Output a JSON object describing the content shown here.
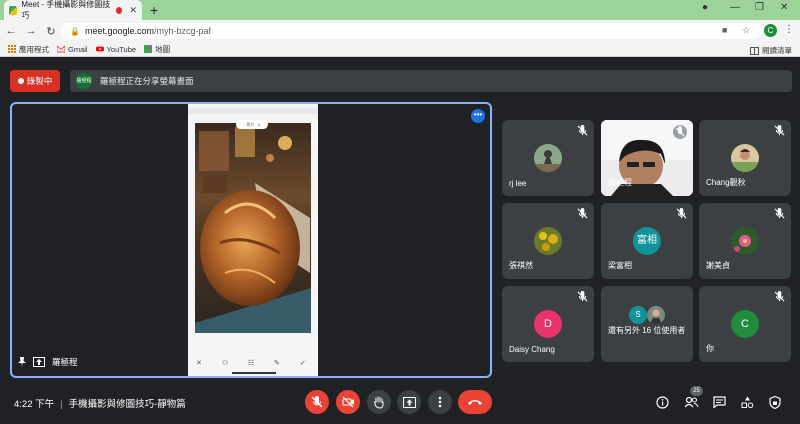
{
  "browser": {
    "tab_title": "Meet - 手機攝影與修圖技巧",
    "url_host": "meet.google.com",
    "url_path": "/myh-bzcg-paf",
    "profile_initial": "C",
    "bookmarks": [
      {
        "label": "應用程式",
        "icon": "apps-grid-icon"
      },
      {
        "label": "Gmail",
        "icon": "gmail-icon"
      },
      {
        "label": "YouTube",
        "icon": "youtube-icon"
      },
      {
        "label": "地圖",
        "icon": "maps-icon"
      }
    ],
    "reading_list": "閱讀清單"
  },
  "meet": {
    "recording_label": "錄製中",
    "presenter_avatar_text": "羅極程",
    "share_banner_text": "羅極程正在分享螢幕畫面",
    "presenter_name": "羅極程",
    "phone_pill_text": "· 原片 · 0",
    "participants": [
      {
        "name": "rj lee",
        "type": "photo"
      },
      {
        "name": "羅極程",
        "type": "video"
      },
      {
        "name": "Chang觀秋",
        "type": "photo"
      },
      {
        "name": "張祺然",
        "type": "photo"
      },
      {
        "name": "梁富相",
        "type": "initials",
        "initials": "富相",
        "color": "#12939a"
      },
      {
        "name": "謝美貞",
        "type": "photo"
      },
      {
        "name": "Daisy Chang",
        "type": "initials",
        "initials": "D",
        "color": "#e8336d"
      },
      {
        "name": "還有另外 16 位使用者",
        "type": "group",
        "initials": "S",
        "color": "#12939a"
      },
      {
        "name": "你",
        "type": "initials",
        "initials": "C",
        "color": "#1e8e3e"
      }
    ],
    "time": "4:22 下午",
    "meeting_title": "手機攝影與修圖技巧-靜物篇",
    "participant_count": "25",
    "colors": {
      "accent": "#8ab4f8",
      "danger": "#ea4335",
      "tile_bg": "#3c4043",
      "page_bg": "#202124"
    }
  }
}
